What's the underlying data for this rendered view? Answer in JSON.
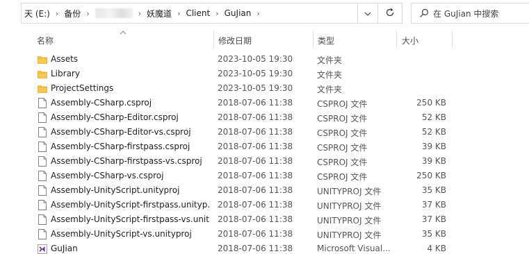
{
  "address_bar": {
    "crumbs": [
      {
        "label": "天 (E:)",
        "redacted": false
      },
      {
        "label": "备份",
        "redacted": false
      },
      {
        "label": "",
        "redacted": true
      },
      {
        "label": "妖魔道",
        "redacted": false
      },
      {
        "label": "Client",
        "redacted": false
      },
      {
        "label": "GuJian",
        "redacted": false
      }
    ],
    "separator": "›",
    "dropdown_icon": "chevron-down-icon",
    "refresh_icon": "refresh-icon"
  },
  "search": {
    "placeholder": "在 GuJian 中搜索",
    "icon": "search-icon"
  },
  "columns": {
    "name": "名称",
    "date": "修改日期",
    "type": "类型",
    "size": "大小",
    "sort_indicator": "ascending"
  },
  "files": [
    {
      "name": "Assets",
      "date": "2023-10-05 19:30",
      "type": "文件夹",
      "size": "",
      "icon": "folder-icon"
    },
    {
      "name": "Library",
      "date": "2023-10-05 19:30",
      "type": "文件夹",
      "size": "",
      "icon": "folder-icon"
    },
    {
      "name": "ProjectSettings",
      "date": "2023-10-05 19:30",
      "type": "文件夹",
      "size": "",
      "icon": "folder-icon"
    },
    {
      "name": "Assembly-CSharp.csproj",
      "date": "2018-07-06 11:38",
      "type": "CSPROJ 文件",
      "size": "250 KB",
      "icon": "file-icon"
    },
    {
      "name": "Assembly-CSharp-Editor.csproj",
      "date": "2018-07-06 11:38",
      "type": "CSPROJ 文件",
      "size": "52 KB",
      "icon": "file-icon"
    },
    {
      "name": "Assembly-CSharp-Editor-vs.csproj",
      "date": "2018-07-06 11:38",
      "type": "CSPROJ 文件",
      "size": "52 KB",
      "icon": "file-icon"
    },
    {
      "name": "Assembly-CSharp-firstpass.csproj",
      "date": "2018-07-06 11:38",
      "type": "CSPROJ 文件",
      "size": "39 KB",
      "icon": "file-icon"
    },
    {
      "name": "Assembly-CSharp-firstpass-vs.csproj",
      "date": "2018-07-06 11:38",
      "type": "CSPROJ 文件",
      "size": "39 KB",
      "icon": "file-icon"
    },
    {
      "name": "Assembly-CSharp-vs.csproj",
      "date": "2018-07-06 11:38",
      "type": "CSPROJ 文件",
      "size": "250 KB",
      "icon": "file-icon"
    },
    {
      "name": "Assembly-UnityScript.unityproj",
      "date": "2018-07-06 11:38",
      "type": "UNITYPROJ 文件",
      "size": "35 KB",
      "icon": "file-icon"
    },
    {
      "name": "Assembly-UnityScript-firstpass.unityp...",
      "date": "2018-07-06 11:38",
      "type": "UNITYPROJ 文件",
      "size": "37 KB",
      "icon": "file-icon"
    },
    {
      "name": "Assembly-UnityScript-firstpass-vs.unit...",
      "date": "2018-07-06 11:38",
      "type": "UNITYPROJ 文件",
      "size": "37 KB",
      "icon": "file-icon"
    },
    {
      "name": "Assembly-UnityScript-vs.unityproj",
      "date": "2018-07-06 11:38",
      "type": "UNITYPROJ 文件",
      "size": "35 KB",
      "icon": "file-icon"
    },
    {
      "name": "GuJian",
      "date": "2018-07-06 11:38",
      "type": "Microsoft Visual...",
      "size": "4 KB",
      "icon": "visual-studio-solution-icon"
    }
  ],
  "colors": {
    "folder": "#F4C94E",
    "folder_dark": "#E3A92C",
    "vs_purple": "#6A2A9A",
    "divider": "#E5E5E5"
  }
}
